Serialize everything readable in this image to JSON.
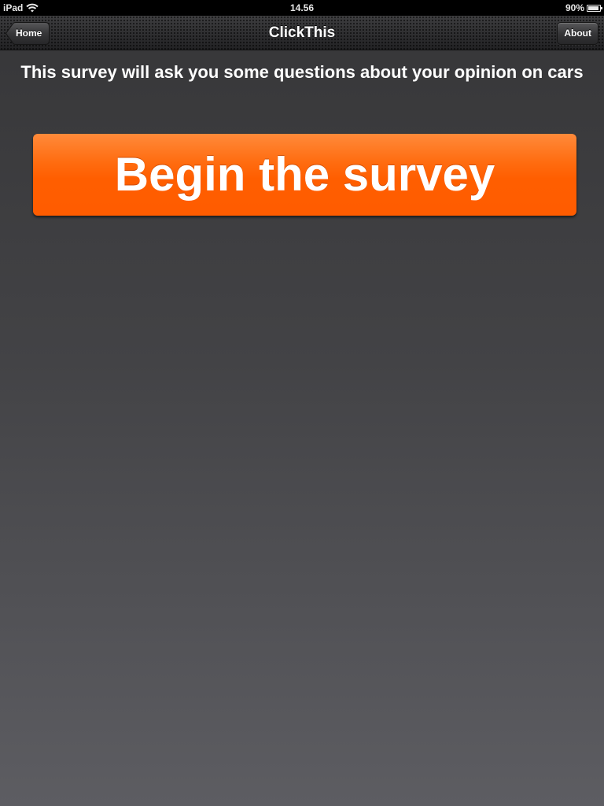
{
  "status_bar": {
    "device": "iPad",
    "time": "14.56",
    "battery": "90%",
    "battery_level": 0.9
  },
  "nav_bar": {
    "title": "ClickThis",
    "back_label": "Home",
    "right_label": "About"
  },
  "content": {
    "intro": "This survey will ask you some questions about your opinion on cars",
    "begin_label": "Begin the survey"
  },
  "colors": {
    "accent": "#ff5e00",
    "background_top": "#363638",
    "background_bottom": "#5d5d62"
  },
  "icons": [
    "wifi-icon",
    "battery-icon",
    "back-arrow-icon"
  ]
}
